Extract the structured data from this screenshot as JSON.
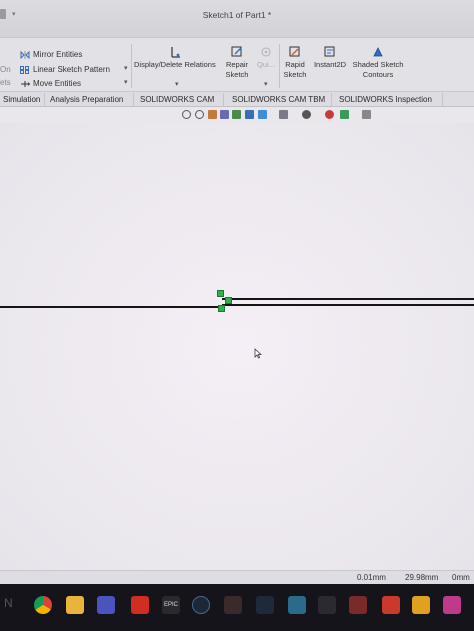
{
  "window": {
    "title": "Sketch1 of Part1 *"
  },
  "ribbon": {
    "left_partial": [
      "",
      "On",
      "ets"
    ],
    "items": [
      {
        "label": "Mirror Entities",
        "icon": "mirror-icon"
      },
      {
        "label": "Linear Sketch Pattern",
        "icon": "linear-pattern-icon"
      },
      {
        "label": "Move Entities",
        "icon": "move-icon"
      }
    ],
    "buttons": [
      {
        "label": "Display/Delete Relations",
        "icon": "relations-icon"
      },
      {
        "label_line1": "Repair",
        "label_line2": "Sketch",
        "icon": "repair-sketch-icon"
      },
      {
        "label": "Qui...",
        "icon": "quick-snaps-icon"
      },
      {
        "label_line1": "Rapid",
        "label_line2": "Sketch",
        "icon": "rapid-sketch-icon"
      },
      {
        "label": "Instant2D",
        "icon": "instant2d-icon"
      },
      {
        "label_line1": "Shaded Sketch",
        "label_line2": "Contours",
        "icon": "shaded-sketch-icon"
      }
    ]
  },
  "tabs": [
    {
      "label": "Simulation"
    },
    {
      "label": "Analysis Preparation"
    },
    {
      "label": "SOLIDWORKS CAM"
    },
    {
      "label": "SOLIDWORKS CAM TBM"
    },
    {
      "label": "SOLIDWORKS Inspection"
    }
  ],
  "status": {
    "value1": "0.01mm",
    "value2": "29.98mm",
    "value3": "0mm"
  },
  "taskbar": {
    "icons": [
      "start-icon",
      "chrome-icon",
      "file-explorer-icon",
      "teams-icon",
      "acrobat-icon",
      "epic-games-icon",
      "steam-icon",
      "app-icon",
      "app-icon",
      "app-icon",
      "word-icon",
      "app-icon",
      "app-icon",
      "app-icon",
      "app-icon"
    ],
    "epic_label": "EPIC"
  },
  "colors": {
    "sketch_node": "#2fb24a",
    "sketch_line": "#151515",
    "taskbar_bg": "#14141a"
  }
}
